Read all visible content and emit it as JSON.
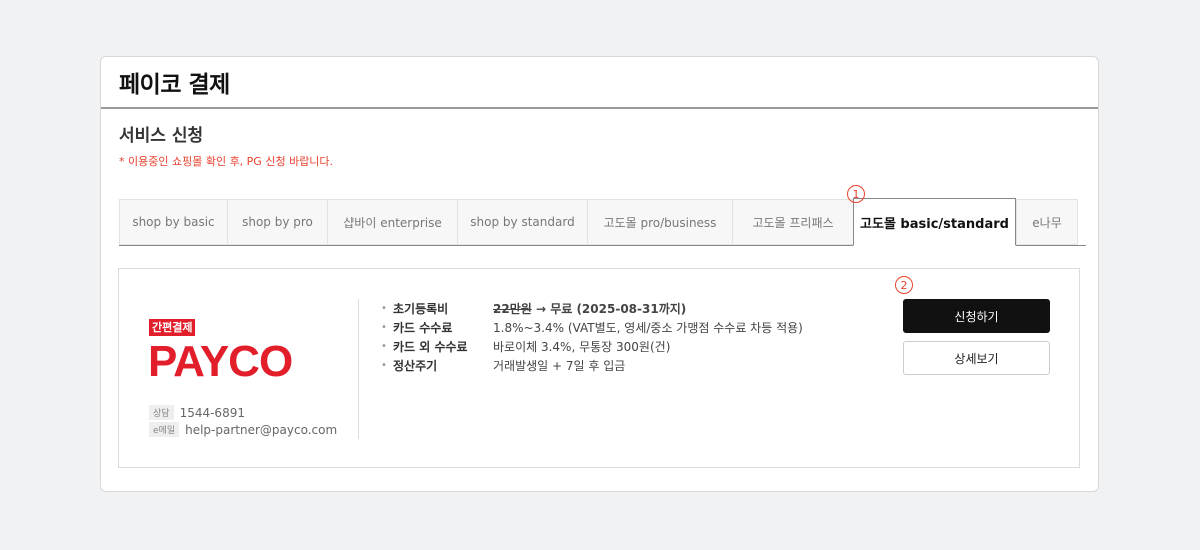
{
  "page": {
    "title": "페이코 결제",
    "section_title": "서비스 신청",
    "notice": "* 이용중인 쇼핑몰 확인 후, PG 신청 바랍니다."
  },
  "tabs": [
    {
      "label": "shop by basic",
      "active": false
    },
    {
      "label": "shop by pro",
      "active": false
    },
    {
      "label": "샵바이 enterprise",
      "active": false
    },
    {
      "label": "shop by standard",
      "active": false
    },
    {
      "label": "고도몰 pro/business",
      "active": false
    },
    {
      "label": "고도몰 프리패스",
      "active": false
    },
    {
      "label": "고도몰 basic/standard",
      "active": true
    },
    {
      "label": "e나무",
      "active": false
    }
  ],
  "markers": {
    "one": "1",
    "two": "2"
  },
  "provider": {
    "badge": "간편결제",
    "brand": "PAYCO",
    "phone_tag": "상담",
    "phone": "1544-6891",
    "email_tag": "e메일",
    "email": "help-partner@payco.com"
  },
  "info": [
    {
      "label": "초기등록비",
      "value_strike": "22만원",
      "value": " → 무료 (2025-08-31까지)"
    },
    {
      "label": "카드 수수료",
      "value": "1.8%~3.4% (VAT별도, 영세/중소 가맹점 수수료 차등 적용)"
    },
    {
      "label": "카드 외 수수료",
      "value": "바로이체 3.4%, 무통장 300원(건)"
    },
    {
      "label": "정산주기",
      "value": "거래발생일 + 7일 후 입금"
    }
  ],
  "buttons": {
    "apply": "신청하기",
    "details": "상세보기"
  },
  "colors": {
    "accent_red": "#e21e2a",
    "notice_red": "#e8412c",
    "primary_button": "#111111"
  }
}
